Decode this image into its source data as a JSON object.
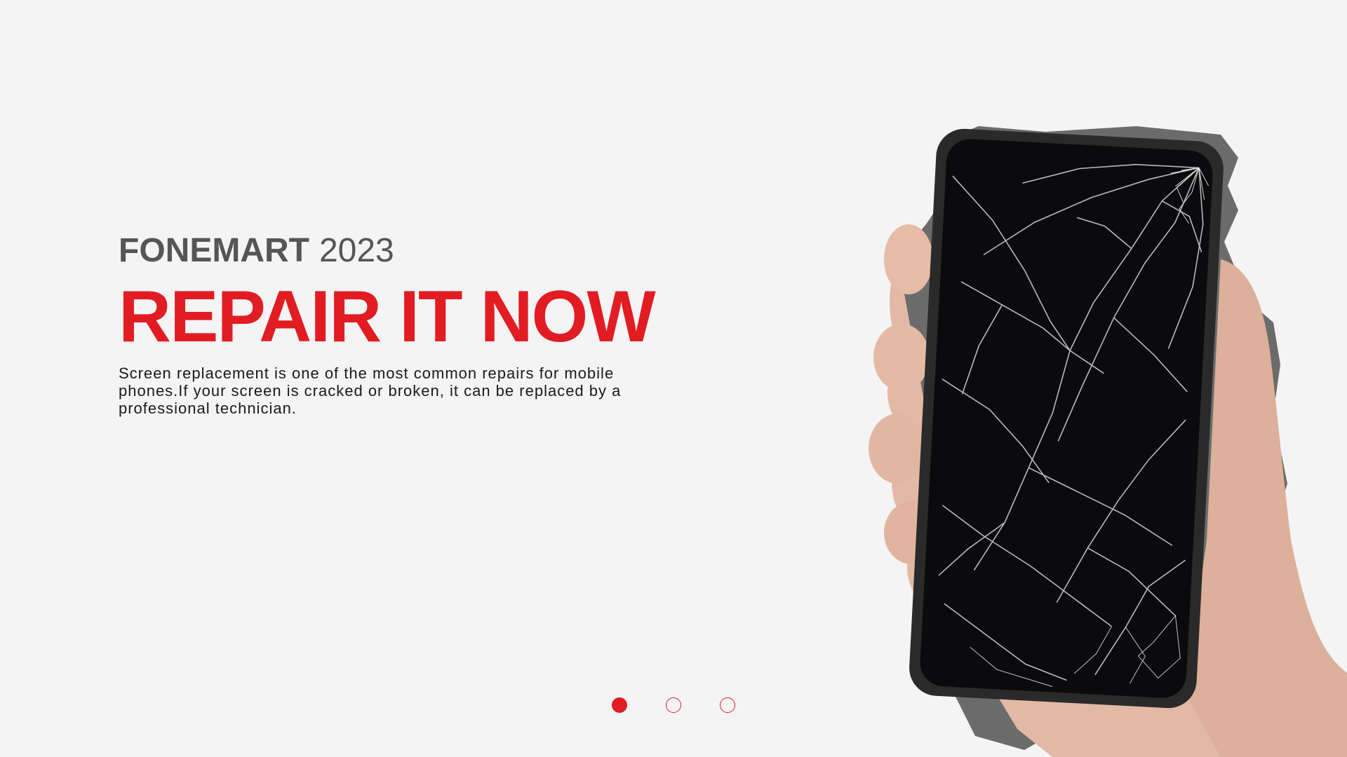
{
  "slide": {
    "kicker_brand": "FONEMART",
    "kicker_year": "2023",
    "headline": "REPAIR IT NOW",
    "description": "Screen replacement is one of the most common repairs for mobile phones.If your screen is cracked or broken, it can be replaced by a professional technician."
  },
  "carousel": {
    "slide_count": 3,
    "active_index": 0
  },
  "hero_image": {
    "icon": "cracked-phone-in-hand-image"
  },
  "colors": {
    "accent": "#e21c23",
    "kicker": "#555555",
    "body_text": "#1a1a1a",
    "background": "#f4f4f4",
    "cutout_shadow": "#6b6b6b"
  }
}
